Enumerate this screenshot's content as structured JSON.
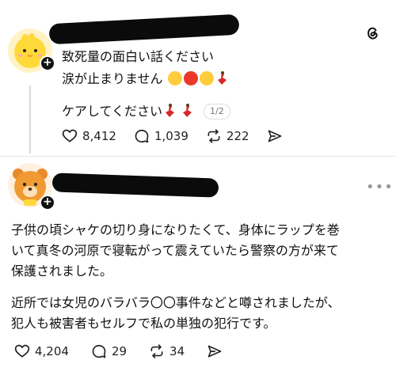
{
  "post1": {
    "line1": "致死量の面白い話ください",
    "line2": "涙が止まりません",
    "line3": "ケアしてください",
    "page_counter": "1/2",
    "likes": "8,412",
    "replies": "1,039",
    "reposts": "222"
  },
  "post2": {
    "para1_line1": "子供の頃シャケの切り身になりたくて、身体にラップを巻",
    "para1_line2": "いて真冬の河原で寝転がって震えていたら警察の方が来て",
    "para1_line3": "保護されました。",
    "para2_line1": "近所では女児のバラバラ〇〇事件などと噂されましたが、",
    "para2_line2": "犯人も被害者もセルフで私の単独の犯行です。",
    "likes": "4,204",
    "replies": "29",
    "reposts": "34"
  },
  "icons": [
    "threads-logo-icon",
    "follow-plus-icon",
    "heart-icon",
    "comment-icon",
    "repost-icon",
    "share-icon",
    "more-options-icon"
  ]
}
